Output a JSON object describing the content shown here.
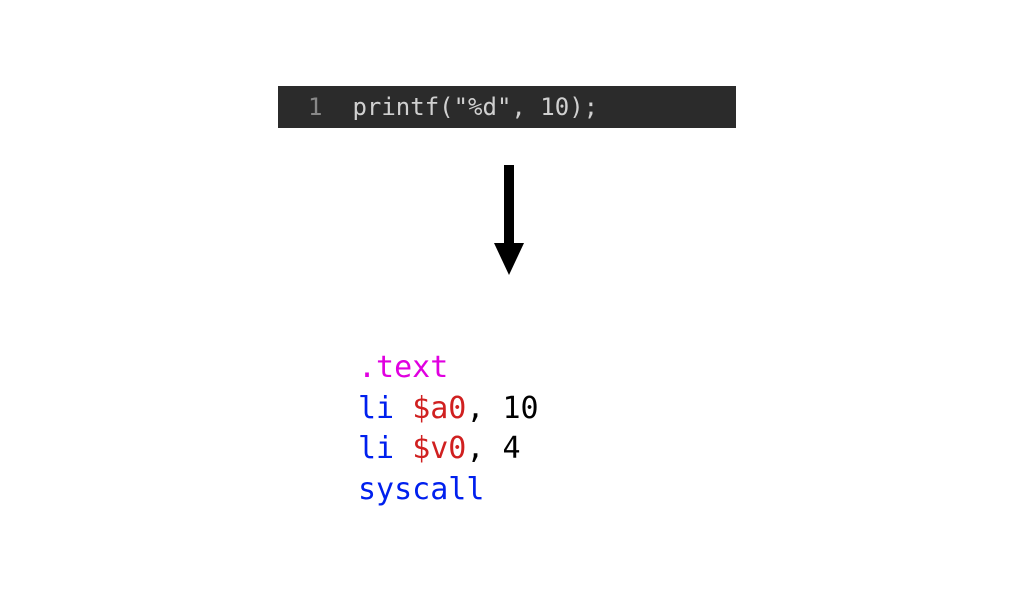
{
  "c_code": {
    "line_number": "1",
    "code": "printf(\"%d\", 10);"
  },
  "assembly": {
    "directive": ".text",
    "line1": {
      "instr": "li",
      "reg": "$a0",
      "rest": ", 10"
    },
    "line2": {
      "instr": "li",
      "reg": "$v0",
      "rest": ", 4"
    },
    "line3": {
      "instr": "syscall"
    }
  }
}
